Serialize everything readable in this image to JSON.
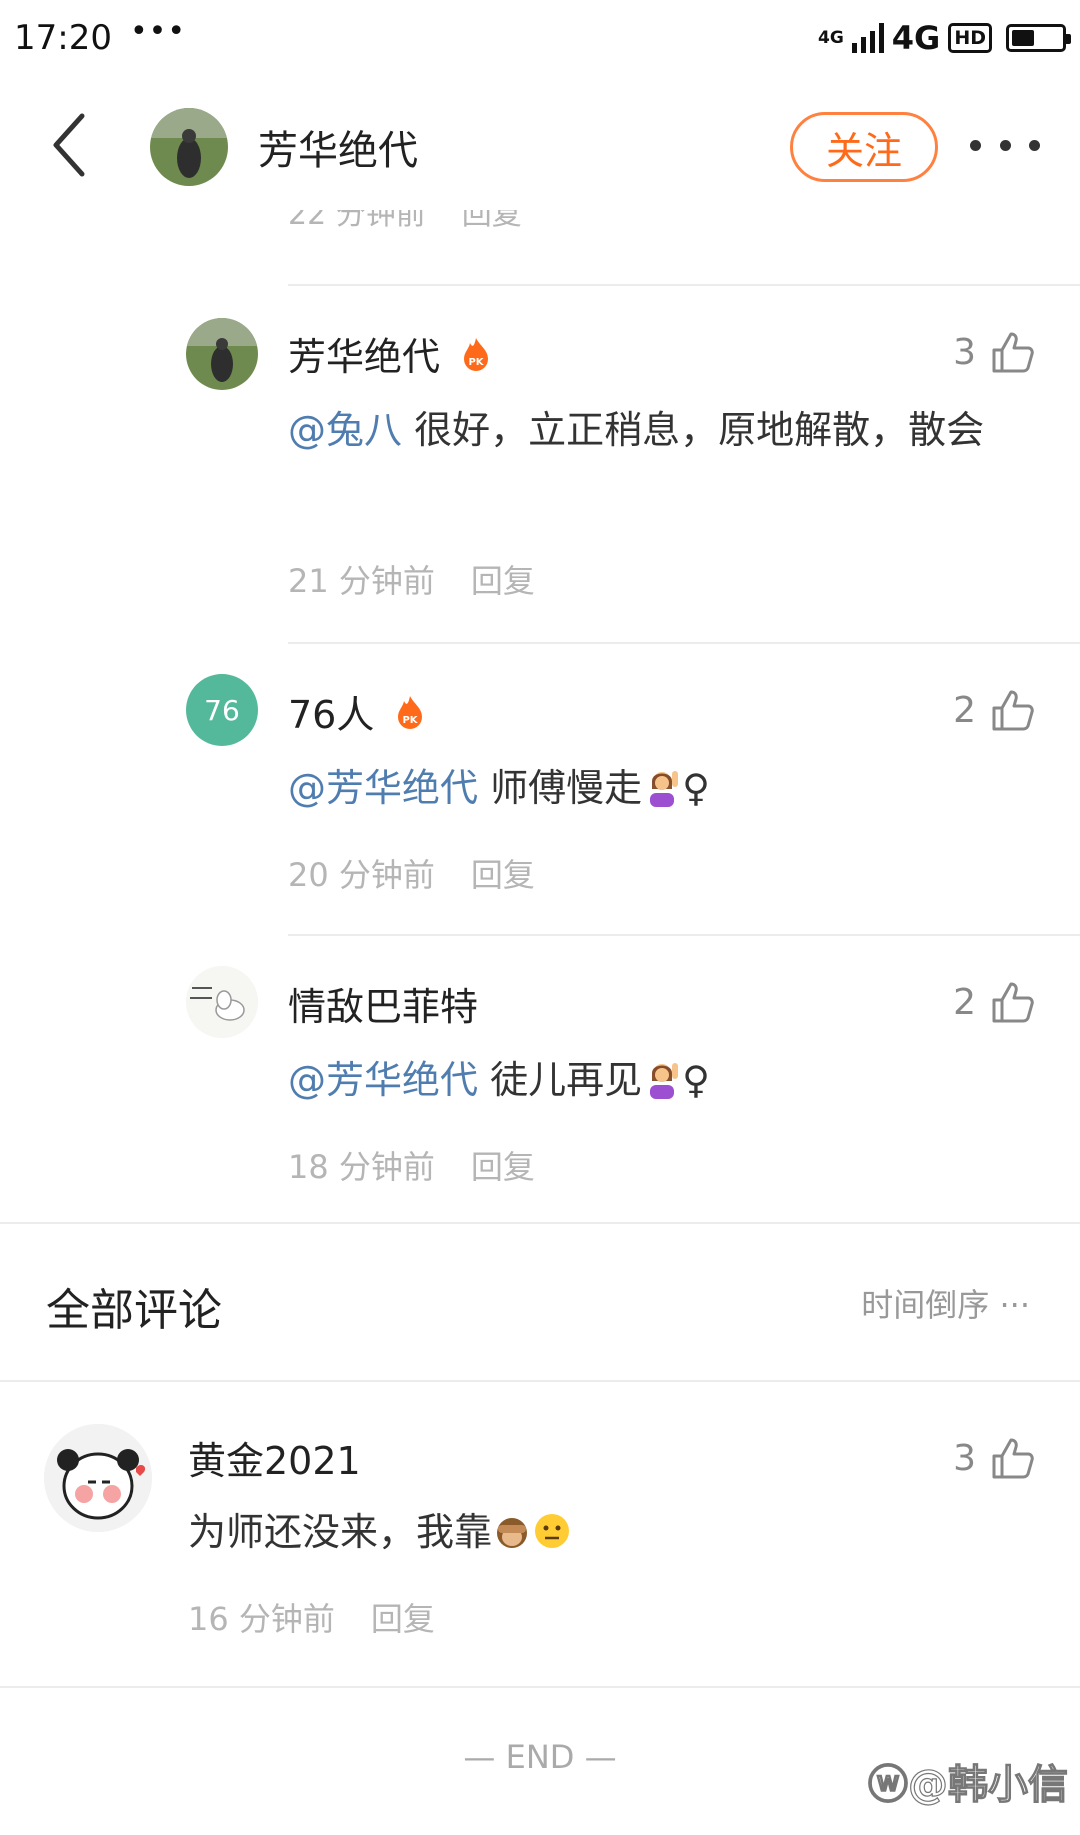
{
  "status_bar": {
    "time": "17:20",
    "dots": "•••",
    "network_small": "4G",
    "network": "4G",
    "hd": "HD",
    "battery_level": 0.45
  },
  "header": {
    "title": "芳华绝代",
    "follow_label": "关注"
  },
  "partial_reply": {
    "time": "22 分钟前",
    "reply_label": "回复"
  },
  "replies": [
    {
      "name": "芳华绝代",
      "likes": "3",
      "mention": "@兔八",
      "text": " 很好，立正稍息，原地解散，散会",
      "time": "21 分钟前",
      "reply_label": "回复"
    },
    {
      "avatar_text": "76",
      "name": "76人",
      "likes": "2",
      "mention": "@芳华绝代",
      "text": " 师傅慢走",
      "suffix": "♀",
      "time": "20 分钟前",
      "reply_label": "回复"
    },
    {
      "name": "情敌巴菲特",
      "likes": "2",
      "mention": "@芳华绝代",
      "text": " 徒儿再见",
      "suffix": "♀",
      "time": "18 分钟前",
      "reply_label": "回复"
    }
  ],
  "all_comments": {
    "title": "全部评论",
    "sort_label": "时间倒序 ···"
  },
  "comments": [
    {
      "name": "黄金2021",
      "likes": "3",
      "text": "为师还没来，我靠",
      "time": "16 分钟前",
      "reply_label": "回复"
    }
  ],
  "footer": {
    "end_label": "— END —",
    "watermark": "ⓦ@韩小信"
  },
  "colors": {
    "accent": "#ff6a1a",
    "mention": "#507daf",
    "muted": "#b5b5b5"
  }
}
